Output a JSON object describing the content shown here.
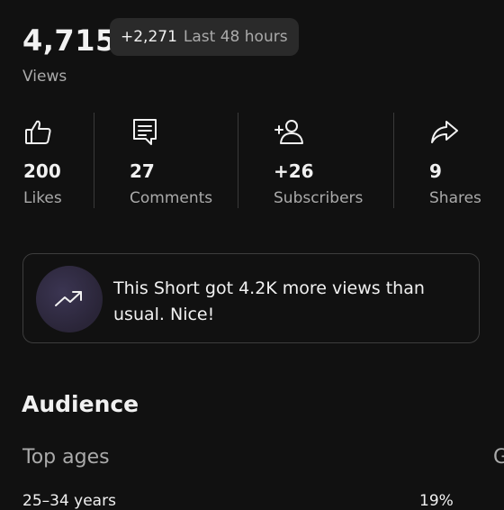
{
  "summary": {
    "views_count": "4,715",
    "views_label": "Views",
    "delta_value": "+2,271",
    "delta_period": "Last 48 hours"
  },
  "stats": [
    {
      "icon": "thumbs-up-icon",
      "value": "200",
      "label": "Likes"
    },
    {
      "icon": "comment-icon",
      "value": "27",
      "label": "Comments"
    },
    {
      "icon": "add-person-icon",
      "value": "+26",
      "label": "Subscribers"
    },
    {
      "icon": "share-icon",
      "value": "9",
      "label": "Shares"
    }
  ],
  "insight": {
    "icon": "trending-up-icon",
    "text": "This Short got 4.2K more views than usual. Nice!"
  },
  "audience": {
    "title": "Audience",
    "top_ages_label": "Top ages",
    "next_tab_partial": "G",
    "rows": [
      {
        "label": "25–34 years",
        "percent": "19%"
      }
    ]
  },
  "colors": {
    "background": "#111111",
    "text": "#f1f1f1",
    "muted": "#aaaaaa",
    "chip": "#2a2a2a",
    "border": "#3d3d3d"
  }
}
